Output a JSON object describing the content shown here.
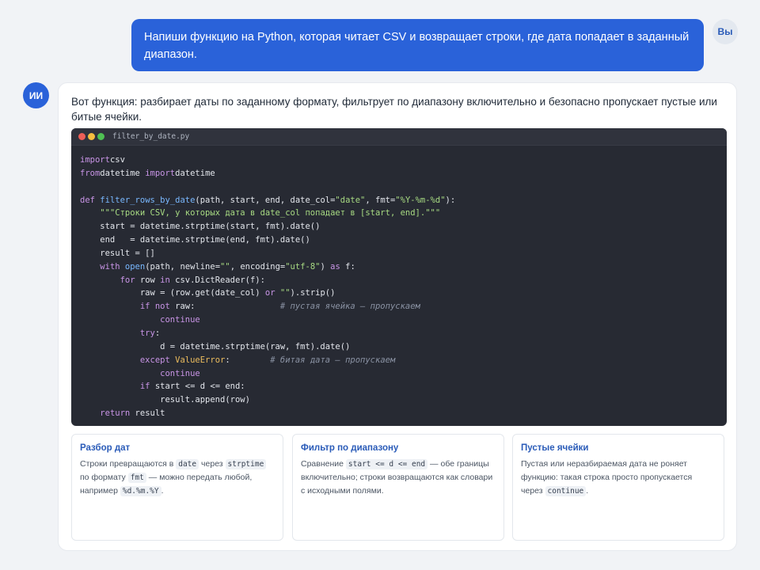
{
  "user_message": {
    "text": "Напиши функцию на Python, которая читает CSV и возвращает строки, где дата попадает в заданный диапазон.",
    "avatar": "Вы"
  },
  "assistant": {
    "avatar": "ИИ",
    "intro": "Вот функция: разбирает даты по заданному формату, фильтрует по диапазону включительно и безопасно пропускает пустые или битые ячейки.",
    "code_window": {
      "filename": "filter_by_date.py",
      "dots": [
        "red-dot-icon",
        "yellow-dot-icon",
        "green-dot-icon"
      ],
      "lines": [
        [
          [
            "kw",
            "import"
          ],
          [
            "",
            "csv"
          ]
        ],
        [
          [
            "kw",
            "from"
          ],
          [
            "",
            "datetime "
          ],
          [
            "kw",
            "import"
          ],
          [
            "",
            "datetime"
          ]
        ],
        [],
        [
          [
            "kw",
            "def "
          ],
          [
            "fn",
            "filter_rows_by_date"
          ],
          [
            "",
            "(path, start, end, date_col="
          ],
          [
            "st",
            "\"date\""
          ],
          [
            "",
            ", fmt="
          ],
          [
            "st",
            "\"%Y-%m-%d\""
          ],
          [
            "",
            "):"
          ]
        ],
        [
          [
            "",
            "    "
          ],
          [
            "st",
            "\"\"\"Строки CSV, у которых дата в date_col попадает в [start, end].\"\"\""
          ]
        ],
        [
          [
            "",
            "    start = datetime.strptime(start, fmt).date()"
          ]
        ],
        [
          [
            "",
            "    end   = datetime.strptime(end, fmt).date()"
          ]
        ],
        [
          [
            "",
            "    result = []"
          ]
        ],
        [
          [
            "",
            "    "
          ],
          [
            "kw",
            "with "
          ],
          [
            "fn",
            "open"
          ],
          [
            "",
            "(path, newline="
          ],
          [
            "st",
            "\"\""
          ],
          [
            "",
            ", encoding="
          ],
          [
            "st",
            "\"utf-8\""
          ],
          [
            "",
            ") "
          ],
          [
            "kw",
            "as"
          ],
          [
            "",
            " f:"
          ]
        ],
        [
          [
            "",
            "        "
          ],
          [
            "kw",
            "for"
          ],
          [
            "",
            " row "
          ],
          [
            "kw",
            "in"
          ],
          [
            "",
            " csv.DictReader(f):"
          ]
        ],
        [
          [
            "",
            "            raw = (row.get(date_col) "
          ],
          [
            "kw",
            "or"
          ],
          [
            "",
            " "
          ],
          [
            "st",
            "\"\""
          ],
          [
            "",
            ").strip()"
          ]
        ],
        [
          [
            "",
            "            "
          ],
          [
            "kw",
            "if not"
          ],
          [
            "",
            " raw:                 "
          ],
          [
            "cm",
            "# пустая ячейка — пропускаем"
          ]
        ],
        [
          [
            "",
            "                "
          ],
          [
            "kw",
            "continue"
          ]
        ],
        [
          [
            "",
            "            "
          ],
          [
            "kw",
            "try"
          ],
          [
            "",
            ":"
          ]
        ],
        [
          [
            "",
            "                d = datetime.strptime(raw, fmt).date()"
          ]
        ],
        [
          [
            "",
            "            "
          ],
          [
            "kw",
            "except "
          ],
          [
            "ex",
            "ValueError"
          ],
          [
            "",
            ":        "
          ],
          [
            "cm",
            "# битая дата — пропускаем"
          ]
        ],
        [
          [
            "",
            "                "
          ],
          [
            "kw",
            "continue"
          ]
        ],
        [
          [
            "",
            "            "
          ],
          [
            "kw",
            "if"
          ],
          [
            "",
            " start <= d <= end:"
          ]
        ],
        [
          [
            "",
            "                result.append(row)"
          ]
        ],
        [
          [
            "",
            "    "
          ],
          [
            "kw",
            "return"
          ],
          [
            "",
            " result"
          ]
        ]
      ]
    },
    "cards": [
      {
        "title": "Разбор дат",
        "body": [
          [
            "t",
            "Строки превращаются в "
          ],
          [
            "c",
            "date"
          ],
          [
            "t",
            " через "
          ],
          [
            "c",
            "strptime"
          ],
          [
            "t",
            " по формату "
          ],
          [
            "c",
            "fmt"
          ],
          [
            "t",
            " — можно передать любой, например "
          ],
          [
            "c",
            "%d.%m.%Y"
          ],
          [
            "t",
            "."
          ]
        ]
      },
      {
        "title": "Фильтр по диапазону",
        "body": [
          [
            "t",
            "Сравнение "
          ],
          [
            "c",
            "start <= d <= end"
          ],
          [
            "t",
            " — обе границы включительно; строки возвращаются как словари с исходными полями."
          ]
        ]
      },
      {
        "title": "Пустые ячейки",
        "body": [
          [
            "t",
            "Пустая или неразбираемая дата не роняет функцию: такая строка просто пропускается через "
          ],
          [
            "c",
            "continue"
          ],
          [
            "t",
            "."
          ]
        ]
      }
    ]
  }
}
